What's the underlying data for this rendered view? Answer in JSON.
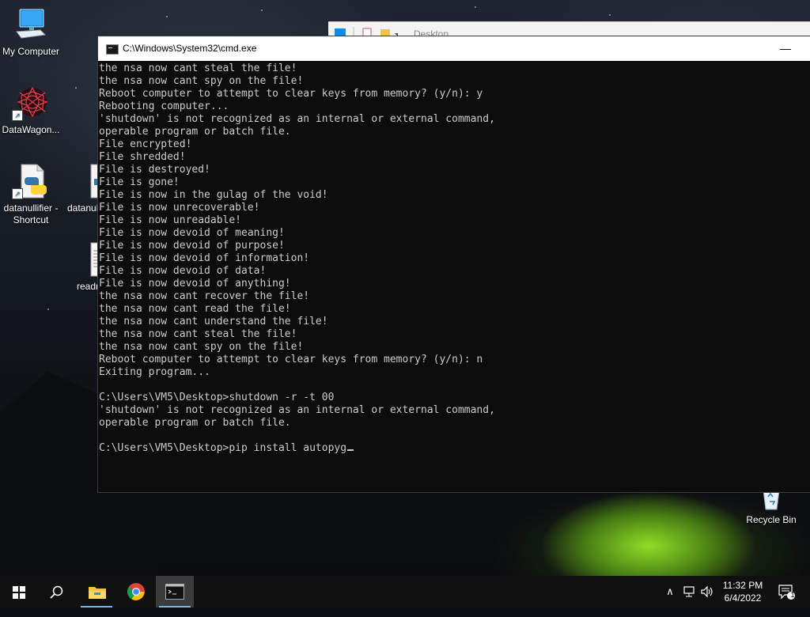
{
  "desktop_icons": {
    "my_computer": "My Computer",
    "datawagon": "DataWagon...",
    "datanullifier_shortcut": "datanullifier - Shortcut",
    "datanullifier": "datanul",
    "readme": "readr",
    "recycle_bin": "Recycle Bin"
  },
  "explorer_window": {
    "title": "Desktop"
  },
  "cmd_window": {
    "title": "C:\\Windows\\System32\\cmd.exe",
    "minimize_glyph": "—",
    "lines": [
      "the nsa now cant steal the file!",
      "the nsa now cant spy on the file!",
      "Reboot computer to attempt to clear keys from memory? (y/n): y",
      "Rebooting computer...",
      "'shutdown' is not recognized as an internal or external command,",
      "operable program or batch file.",
      "File encrypted!",
      "File shredded!",
      "File is destroyed!",
      "File is gone!",
      "File is now in the gulag of the void!",
      "File is now unrecoverable!",
      "File is now unreadable!",
      "File is now devoid of meaning!",
      "File is now devoid of purpose!",
      "File is now devoid of information!",
      "File is now devoid of data!",
      "File is now devoid of anything!",
      "the nsa now cant recover the file!",
      "the nsa now cant read the file!",
      "the nsa now cant understand the file!",
      "the nsa now cant steal the file!",
      "the nsa now cant spy on the file!",
      "Reboot computer to attempt to clear keys from memory? (y/n): n",
      "Exiting program...",
      "",
      "C:\\Users\\VM5\\Desktop>shutdown -r -t 00",
      "'shutdown' is not recognized as an internal or external command,",
      "operable program or batch file.",
      ""
    ],
    "prompt": "C:\\Users\\VM5\\Desktop>pip install autopyg"
  },
  "taskbar": {
    "time": "11:32 PM",
    "date": "6/4/2022",
    "notification_count": "1",
    "up_arrow_glyph": "∧"
  },
  "colors": {
    "console_bg": "#0c0c0c",
    "console_text": "#cccccc",
    "taskbar_bg": "#101010",
    "accent": "#76b9ed"
  }
}
